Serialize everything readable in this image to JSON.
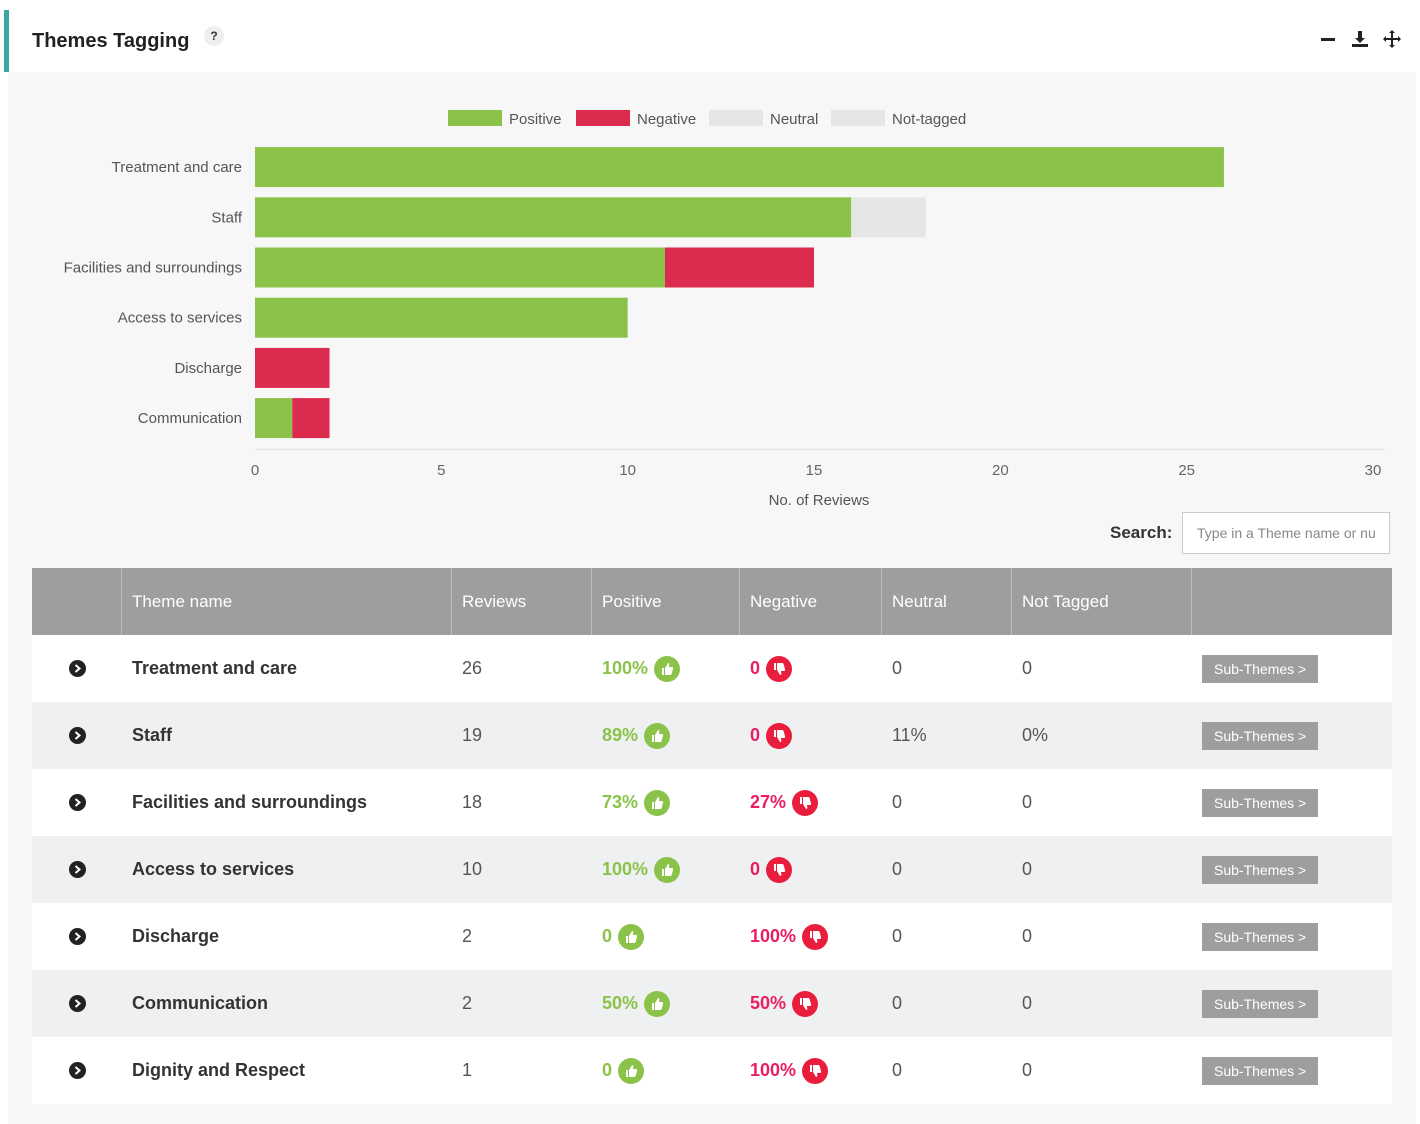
{
  "header": {
    "title": "Themes Tagging",
    "help": "?"
  },
  "tools": {
    "minimize_icon": "minus-icon",
    "download_icon": "download-icon",
    "move_icon": "move-icon"
  },
  "colors": {
    "positive": "#8bc34a",
    "negative": "#dd2a4f",
    "neutral": "#e6e6e4",
    "not_tagged": "#e6e6e4"
  },
  "chart_data": {
    "type": "bar",
    "orientation": "horizontal",
    "stacked": true,
    "categories": [
      "Treatment and care",
      "Staff",
      "Facilities and surroundings",
      "Access to services",
      "Discharge",
      "Communication"
    ],
    "series": [
      {
        "name": "Positive",
        "values": [
          26,
          16,
          11,
          10,
          0,
          1
        ]
      },
      {
        "name": "Negative",
        "values": [
          0,
          0,
          4,
          0,
          2,
          1
        ]
      },
      {
        "name": "Neutral",
        "values": [
          0,
          2,
          0,
          0,
          0,
          0
        ]
      },
      {
        "name": "Not-tagged",
        "values": [
          0,
          0,
          0,
          0,
          0,
          0
        ]
      }
    ],
    "xlabel": "No. of Reviews",
    "xlim": [
      0,
      30
    ],
    "xticks": [
      "0",
      "5",
      "10",
      "15",
      "20",
      "25",
      "30"
    ],
    "legend_position": "top"
  },
  "search": {
    "label": "Search:",
    "placeholder": "Type in a Theme name or number"
  },
  "table": {
    "columns": [
      "",
      "Theme name",
      "Reviews",
      "Positive",
      "Negative",
      "Neutral",
      "Not Tagged",
      ""
    ],
    "subthemes_label": "Sub-Themes >",
    "rows": [
      {
        "name": "Treatment and care",
        "reviews": "26",
        "positive": "100%",
        "negative": "0",
        "neutral": "0",
        "not_tagged": "0"
      },
      {
        "name": "Staff",
        "reviews": "19",
        "positive": "89%",
        "negative": "0",
        "neutral": "11%",
        "not_tagged": "0%"
      },
      {
        "name": "Facilities and surroundings",
        "reviews": "18",
        "positive": "73%",
        "negative": "27%",
        "neutral": "0",
        "not_tagged": "0"
      },
      {
        "name": "Access to services",
        "reviews": "10",
        "positive": "100%",
        "negative": "0",
        "neutral": "0",
        "not_tagged": "0"
      },
      {
        "name": "Discharge",
        "reviews": "2",
        "positive": "0",
        "negative": "100%",
        "neutral": "0",
        "not_tagged": "0"
      },
      {
        "name": "Communication",
        "reviews": "2",
        "positive": "50%",
        "negative": "50%",
        "neutral": "0",
        "not_tagged": "0"
      },
      {
        "name": "Dignity and Respect",
        "reviews": "1",
        "positive": "0",
        "negative": "100%",
        "neutral": "0",
        "not_tagged": "0"
      }
    ]
  }
}
